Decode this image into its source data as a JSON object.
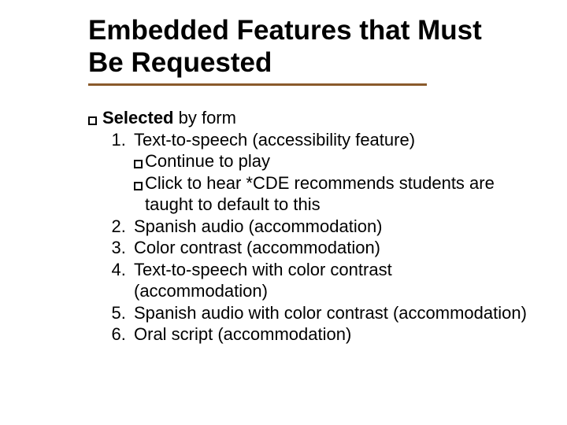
{
  "title_line1": "Embedded Features that Must",
  "title_line2": "Be Requested",
  "heading_bold": "Selected",
  "heading_rest": " by form",
  "items": [
    "Text-to-speech (accessibility feature)",
    "Spanish audio (accommodation)",
    "Color contrast (accommodation)",
    "Text-to-speech with color contrast (accommodation)",
    "Spanish audio with color contrast (accommodation)",
    "Oral script (accommodation)"
  ],
  "sub_a": "Continue to play",
  "sub_b": "Click to hear *CDE recommends students are taught to default to this"
}
